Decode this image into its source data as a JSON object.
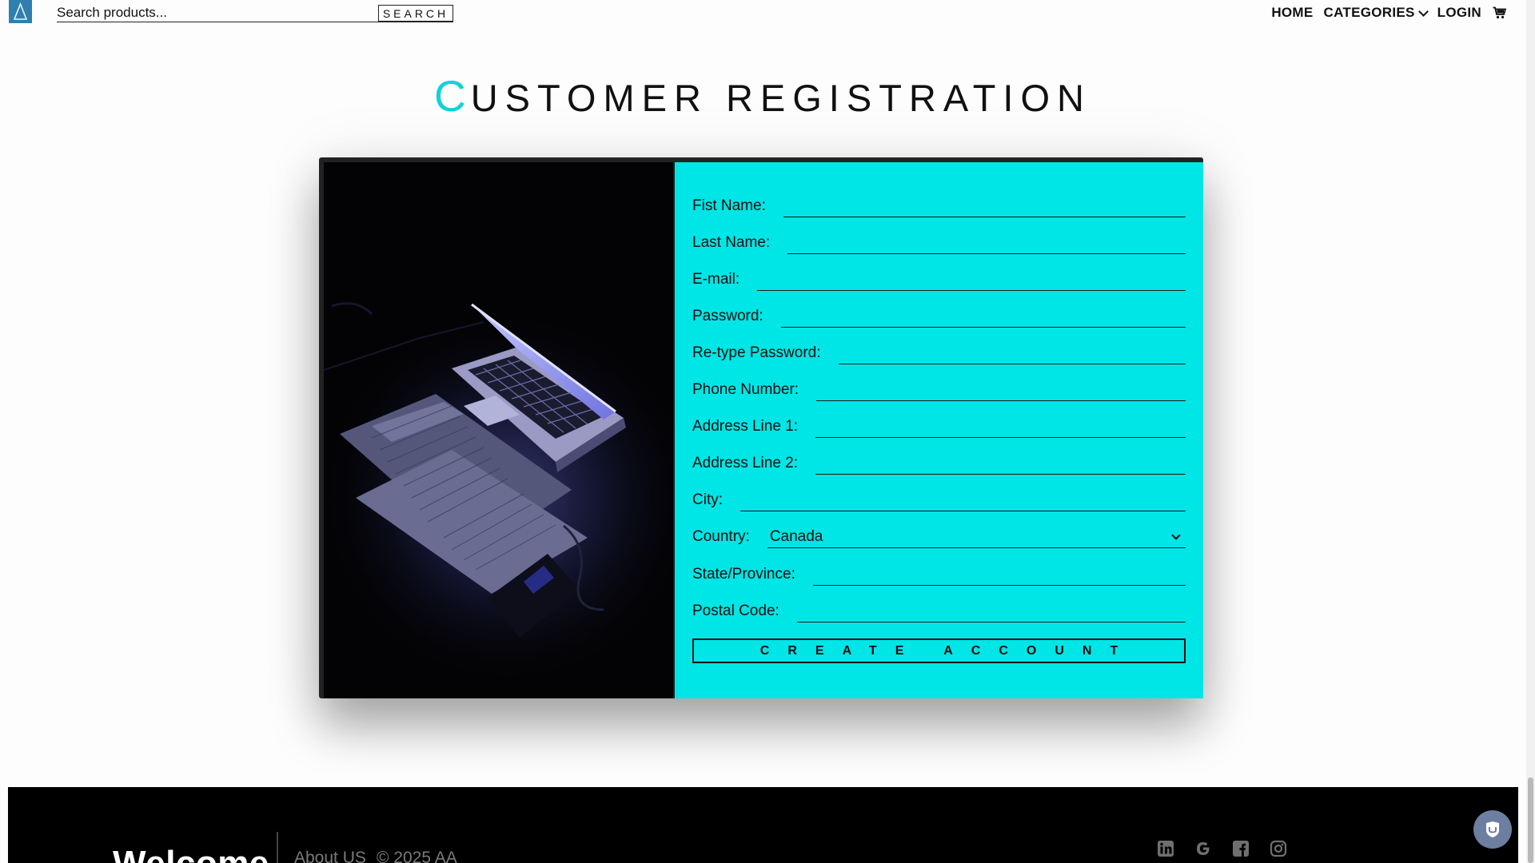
{
  "header": {
    "search": {
      "placeholder": "Search products...",
      "button_label": "SEARCH"
    },
    "nav": {
      "home": "HOME",
      "categories": "CATEGORIES",
      "login": "LOGIN"
    }
  },
  "page": {
    "title_first": "C",
    "title_rest": "USTOMER REGISTRATION"
  },
  "form": {
    "fields": [
      {
        "label": "Fist Name:"
      },
      {
        "label": "Last Name:"
      },
      {
        "label": "E-mail:"
      },
      {
        "label": "Password:"
      },
      {
        "label": "Re-type Password:"
      },
      {
        "label": "Phone Number:"
      },
      {
        "label": "Address Line 1:"
      },
      {
        "label": "Address Line 2:"
      },
      {
        "label": "City:"
      }
    ],
    "country": {
      "label": "Country:",
      "value": "Canada"
    },
    "state": {
      "label": "State/Province:"
    },
    "postal": {
      "label": "Postal Code:"
    },
    "submit_label": "CREATE ACCOUNT"
  },
  "footer": {
    "welcome": "Welcome",
    "about": "About US",
    "copyright": "© 2025 AA",
    "social_icons": [
      "linkedin-icon",
      "google-icon",
      "facebook-icon",
      "instagram-icon"
    ]
  },
  "colors": {
    "accent": "#00e5e5",
    "title_accent": "#0fd2dc",
    "logo": "#2f7fb0",
    "footer_bg": "#000000",
    "help_button": "#6d7fa0"
  }
}
